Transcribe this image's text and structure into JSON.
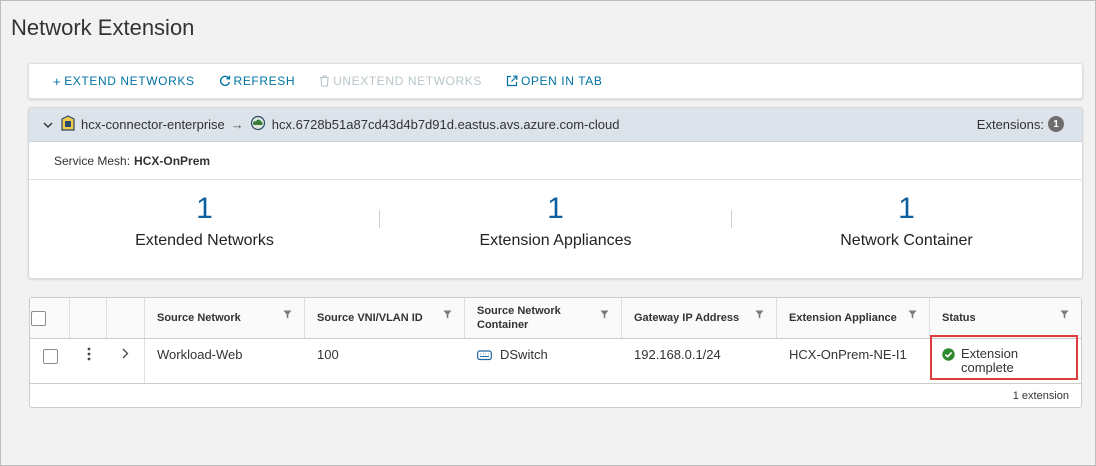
{
  "page": {
    "title": "Network Extension"
  },
  "toolbar": {
    "extend_label": "EXTEND NETWORKS",
    "refresh_label": "REFRESH",
    "unextend_label": "UNEXTEND NETWORKS",
    "open_tab_label": "OPEN IN TAB"
  },
  "pair": {
    "source_site": "hcx-connector-enterprise",
    "arrow": "→",
    "destination_site": "hcx.6728b51a87cd43d4b7d91d.eastus.avs.azure.com-cloud",
    "extensions_label": "Extensions:",
    "extensions_count": "1"
  },
  "service_mesh": {
    "label": "Service Mesh:",
    "value": "HCX-OnPrem"
  },
  "stats": [
    {
      "value": "1",
      "label": "Extended Networks"
    },
    {
      "value": "1",
      "label": "Extension Appliances"
    },
    {
      "value": "1",
      "label": "Network Container"
    }
  ],
  "grid": {
    "columns": [
      "Source Network",
      "Source VNI/VLAN ID",
      "Source Network Container",
      "Gateway IP Address",
      "Extension Appliance",
      "Status"
    ],
    "rows": [
      {
        "source_network": "Workload-Web",
        "vni": "100",
        "container": "DSwitch",
        "gateway": "192.168.0.1/24",
        "appliance": "HCX-OnPrem-NE-I1",
        "status": "Extension complete"
      }
    ],
    "footer": "1 extension"
  },
  "colors": {
    "accent": "#0072a3",
    "stat_number": "#0c5f9e",
    "status_ok": "#2f8a2f",
    "highlight": "#e03c3c"
  }
}
